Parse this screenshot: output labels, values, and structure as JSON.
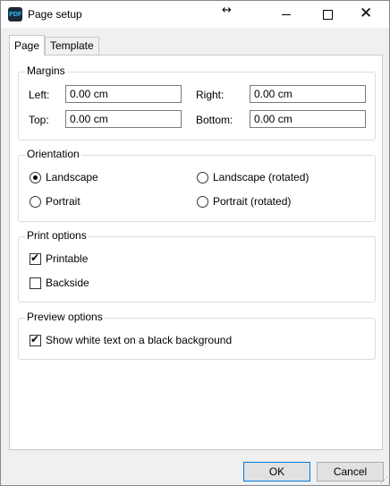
{
  "window": {
    "title": "Page setup",
    "app_icon_text": "PDF",
    "resize_glyph": "↔",
    "close_glyph": "✕"
  },
  "tabs": [
    {
      "label": "Page",
      "active": true
    },
    {
      "label": "Template",
      "active": false
    }
  ],
  "margins": {
    "title": "Margins",
    "left_label": "Left:",
    "left_value": "0.00 cm",
    "right_label": "Right:",
    "right_value": "0.00 cm",
    "top_label": "Top:",
    "top_value": "0.00 cm",
    "bottom_label": "Bottom:",
    "bottom_value": "0.00 cm"
  },
  "orientation": {
    "title": "Orientation",
    "options": [
      {
        "label": "Landscape",
        "selected": true
      },
      {
        "label": "Landscape (rotated)",
        "selected": false
      },
      {
        "label": "Portrait",
        "selected": false
      },
      {
        "label": "Portrait (rotated)",
        "selected": false
      }
    ]
  },
  "print_options": {
    "title": "Print options",
    "printable_label": "Printable",
    "printable_checked": true,
    "backside_label": "Backside",
    "backside_checked": false
  },
  "preview_options": {
    "title": "Preview options",
    "white_on_black_label": "Show white text on a black background",
    "white_on_black_checked": true
  },
  "buttons": {
    "ok_label": "OK",
    "cancel_label": "Cancel"
  },
  "colors": {
    "accent": "#0078d7",
    "icon_bg": "#1b2a3a",
    "icon_fg": "#29a8e0"
  }
}
